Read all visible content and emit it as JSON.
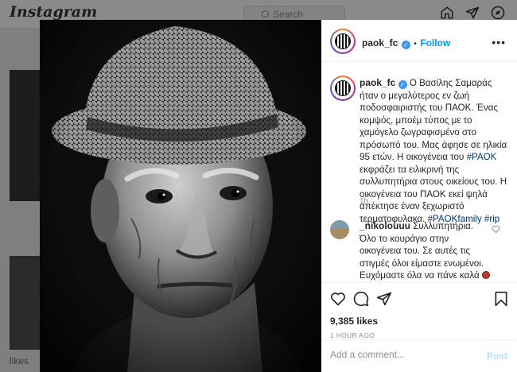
{
  "app": {
    "logo": "Instagram"
  },
  "search": {
    "placeholder": "Search"
  },
  "nav": {
    "icons": [
      "home-icon",
      "direct-icon",
      "explore-icon"
    ]
  },
  "photo": {
    "alt": "black and white portrait of an elderly man wearing a houndstooth hat"
  },
  "post": {
    "username": "paok_fc",
    "follow_label": "Follow",
    "separator": "•",
    "caption": {
      "username": "paok_fc",
      "text_1": "Ο Βασίλης Σαμαράς ήταν ο μεγαλύτερος εν ζωή ποδοσφαιριστής του ΠΑΟΚ. Ένας κομψός, μποέμ τύπος με το χαμόγελο ζωγραφισμένο στο πρόσωπό του. Μας άφησε σε ηλικία 95 ετών. Η οικογένεια του",
      "tag_1": "#PAOK",
      "text_2": "εκφράζει τα ειλικρινή της συλλυπητήρια στους οικείους του. Η οικογένεια του ΠΑΟΚ εκεί ψηλά απέκτησε έναν ξεχωριστό τερματοφυλακα.",
      "tag_2": "#PAOKfamily",
      "tag_3": "#rip"
    },
    "caption_time": "1h",
    "comment": {
      "username": "_nikolouuu",
      "text": "Συλλυπητήρια. Όλο το κουράγιο στην οικογένεια του. Σε αυτές τις στιγμές όλοι είμαστε ενωμένοι. Ευχόμαστε όλα να πάνε καλά",
      "emoji_colors": [
        "#d32f2f",
        "#ffffff",
        "#222222",
        "#ffffff"
      ]
    },
    "likes": "9,385 likes",
    "time_ago": "1 HOUR AGO",
    "comment_box": {
      "placeholder": "Add a comment...",
      "post_label": "Post"
    }
  },
  "colors": {
    "accent": "#0095f6",
    "verified": "#3897f0",
    "post_disabled": "#b2dffc"
  }
}
